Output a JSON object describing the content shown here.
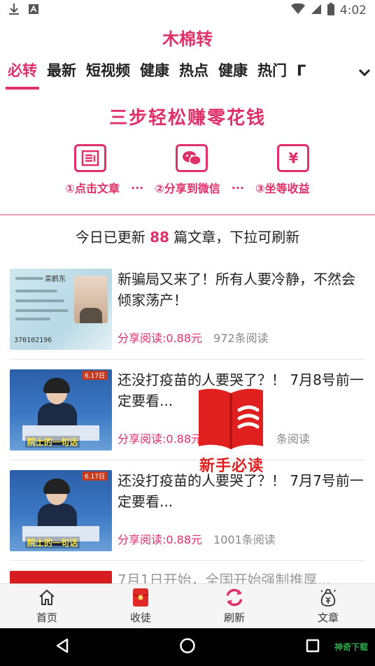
{
  "status_bar": {
    "time": "4:02"
  },
  "app": {
    "title": "木棉转"
  },
  "tabs": [
    {
      "label": "必转",
      "active": true
    },
    {
      "label": "最新",
      "active": false
    },
    {
      "label": "短视频",
      "active": false
    },
    {
      "label": "健康",
      "active": false
    },
    {
      "label": "热点",
      "active": false
    },
    {
      "label": "健康",
      "active": false
    },
    {
      "label": "热门",
      "active": false
    },
    {
      "label": "Γ",
      "active": false
    }
  ],
  "steps": {
    "title": "三步轻松赚零花钱",
    "items": [
      {
        "label": "①点击文章",
        "icon": "article-icon"
      },
      {
        "label": "②分享到微信",
        "icon": "wechat-icon"
      },
      {
        "label": "③坐等收益",
        "icon": "yen-icon",
        "glyph": "¥"
      }
    ],
    "separator": "···"
  },
  "update": {
    "prefix": "今日已更新",
    "count": "88",
    "suffix": "篇文章，下拉可刷新"
  },
  "articles": [
    {
      "title": "新骗局又来了！所有人要冷静，不然会倾家荡产！",
      "share": "分享阅读:0.88元",
      "reads": "972条阅读",
      "thumb": "idcard",
      "thumb_text": {
        "name": "栾鹤东",
        "number": "370102196"
      }
    },
    {
      "title": "还没打疫苗的人要哭了？！ 7月8号前一定要看...",
      "share": "分享阅读:0.88元",
      "reads": "条阅读",
      "thumb": "speech",
      "thumb_text": {
        "caption": "院士的一句话",
        "tag": "6.17日"
      }
    },
    {
      "title": "还没打疫苗的人要哭了？！ 7月7号前一定要看...",
      "share": "分享阅读:0.88元",
      "reads": "1001条阅读",
      "thumb": "speech",
      "thumb_text": {
        "caption": "院士的一句话",
        "tag": "6.17日"
      }
    },
    {
      "title": "7月1日开始，全国开始强制推厚...",
      "share": "",
      "reads": "",
      "thumb": "red",
      "thumb_text": {}
    }
  ],
  "newbie": {
    "label": "新手必读"
  },
  "bottom_nav": [
    {
      "label": "首页",
      "icon": "home-icon"
    },
    {
      "label": "收徒",
      "icon": "red-envelope-icon"
    },
    {
      "label": "刷新",
      "icon": "refresh-icon"
    },
    {
      "label": "文章",
      "icon": "money-bag-icon"
    }
  ],
  "watermark": "神奇下载",
  "colors": {
    "accent": "#e0306a",
    "text": "#222222",
    "muted": "#888888"
  }
}
